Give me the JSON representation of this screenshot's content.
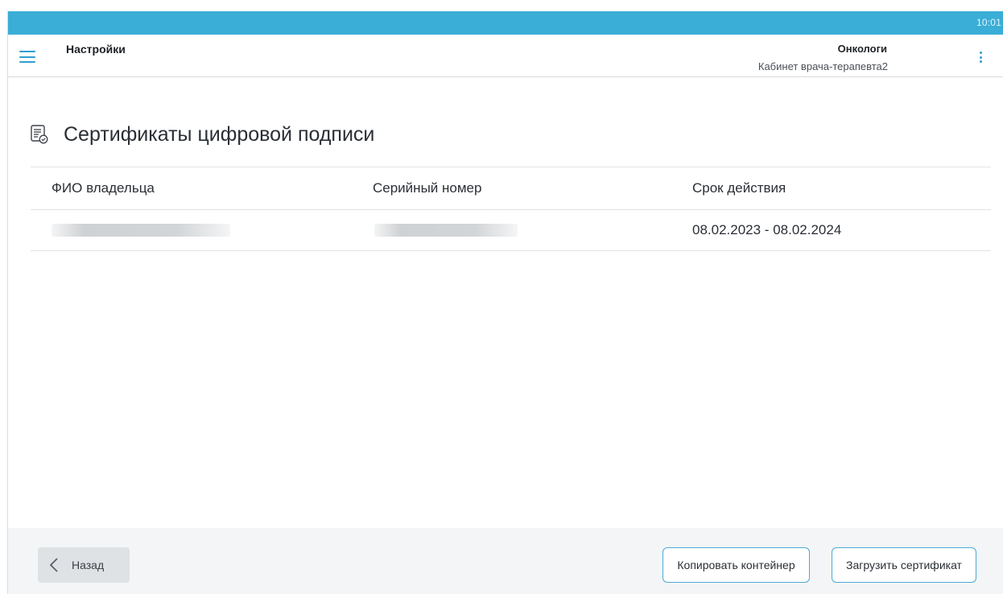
{
  "status_bar": {
    "time": "10:01"
  },
  "header": {
    "title": "Настройки",
    "org": "Онкологи",
    "cabinet": "Кабинет врача-терапевта2",
    "menu_icon": "hamburger-menu-icon",
    "more_icon": "kebab-more-icon"
  },
  "page": {
    "title": "Сертификаты цифровой подписи",
    "icon": "certificate-icon"
  },
  "table": {
    "columns": [
      "ФИО владельца",
      "Серийный номер",
      "Срок действия"
    ],
    "rows": [
      {
        "owner": "",
        "serial": "",
        "validity": "08.02.2023 - 08.02.2024"
      }
    ]
  },
  "footer": {
    "back_label": "Назад",
    "copy_label": "Копировать контейнер",
    "upload_label": "Загрузить сертификат"
  },
  "colors": {
    "accent": "#3aaed6",
    "button_border": "#4aa9d6",
    "footer_bg": "#f4f5f6"
  }
}
